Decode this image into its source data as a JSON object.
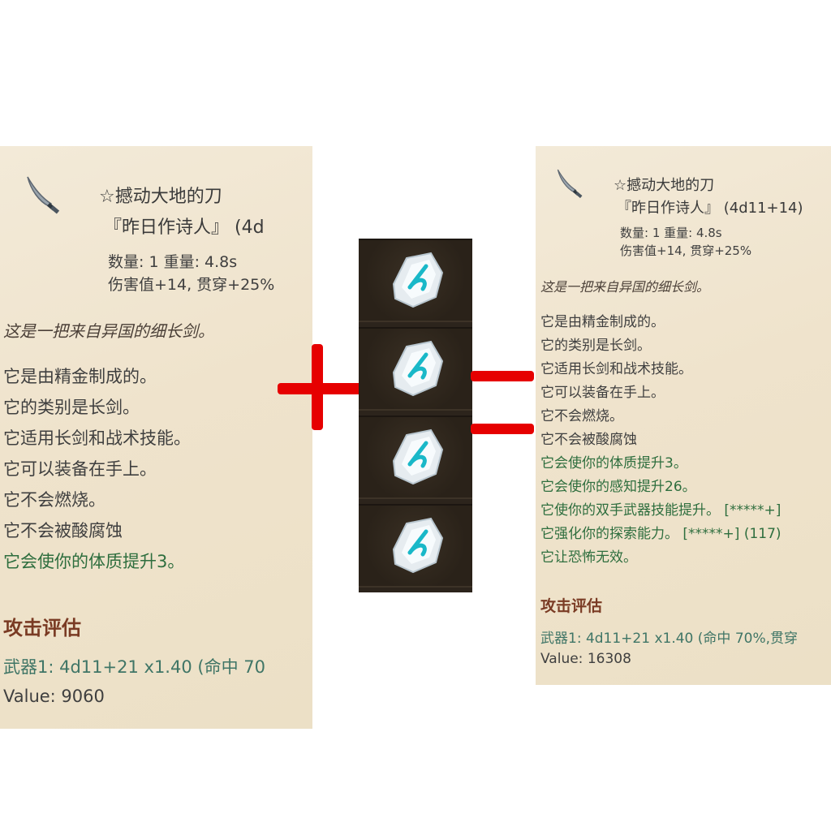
{
  "left_card": {
    "item_name": "☆撼动大地的刀",
    "item_subtitle": "『昨日作诗人』 (4d",
    "stats_line1": "数量: 1 重量: 4.8s",
    "stats_line2": "伤害值+14, 贯穿+25%",
    "description": "这是一把来自异国的细长剑。",
    "properties": [
      "它是由精金制成的。",
      "它的类别是长剑。",
      "它适用长剑和战术技能。",
      "它可以装备在手上。",
      "它不会燃烧。",
      "它不会被酸腐蚀"
    ],
    "enchantments": [
      "它会使你的体质提升3。"
    ],
    "attack_header": "攻击评估",
    "weapon_line": "武器1: 4d11+21 x1.40 (命中 70",
    "value_line": "Value: 9060"
  },
  "gems": {
    "count": 4,
    "icon": "white-gem-with-cyan-rune-icon"
  },
  "operators": {
    "plus": "plus-sign",
    "equals": "equals-sign",
    "color": "#e60000"
  },
  "right_card": {
    "item_name": "☆撼动大地的刀",
    "item_subtitle": "『昨日作诗人』 (4d11+14)",
    "stats_line1": "数量: 1 重量: 4.8s",
    "stats_line2": "伤害值+14, 贯穿+25%",
    "description": "这是一把来自异国的细长剑。",
    "properties": [
      "它是由精金制成的。",
      "它的类别是长剑。",
      "它适用长剑和战术技能。",
      "它可以装备在手上。",
      "它不会燃烧。",
      "它不会被酸腐蚀"
    ],
    "enchantments": [
      "它会使你的体质提升3。",
      "它会使你的感知提升26。",
      "它使你的双手武器技能提升。 [*****+]",
      "它强化你的探索能力。 [*****+] (117)",
      "它让恐怖无效。"
    ],
    "attack_header": "攻击评估",
    "weapon_line": "武器1: 4d11+21 x1.40 (命中 70%,贯穿",
    "value_line": "Value: 16308"
  },
  "colors": {
    "parchment": "#efe3cc",
    "text": "#3f3f3f",
    "enchant_green": "#2e6e3e",
    "header_brown": "#7a3b24"
  }
}
